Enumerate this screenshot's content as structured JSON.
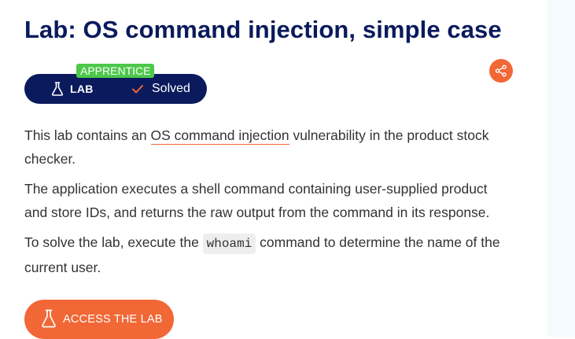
{
  "page": {
    "title": "Lab: OS command injection, simple case"
  },
  "badge": {
    "level": "APPRENTICE",
    "lab_label": "LAB",
    "status": "Solved"
  },
  "share": {
    "icon": "share-icon"
  },
  "description": {
    "p1_before": "This lab contains an ",
    "p1_link": "OS command injection",
    "p1_after": " vulnerability in the product stock checker.",
    "p2": "The application executes a shell command containing user-supplied product and store IDs, and returns the raw output from the command in its response.",
    "p3_before": "To solve the lab, execute the ",
    "p3_code": "whoami",
    "p3_after": " command to determine the name of the current user."
  },
  "actions": {
    "access_label": "ACCESS THE LAB"
  },
  "colors": {
    "title": "#0a1a5c",
    "pill_bg": "#0a1a5c",
    "accent": "#f16736",
    "level_badge": "#4cc84a",
    "side_panel": "#f4fafd"
  }
}
